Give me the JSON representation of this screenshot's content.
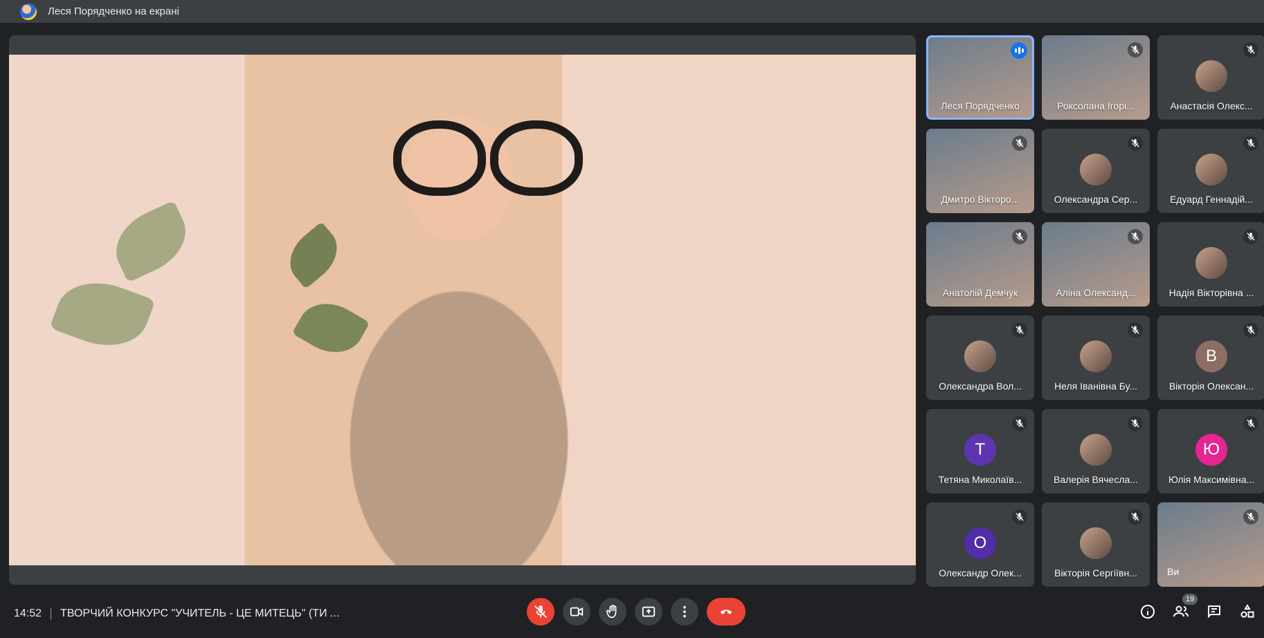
{
  "presenter_bar": {
    "text": "Леся Порядченко на екрані"
  },
  "participants": [
    {
      "name": "Леся Порядченко",
      "type": "video",
      "state": "speaking"
    },
    {
      "name": "Роксолана Ігорі...",
      "type": "video",
      "state": "muted"
    },
    {
      "name": "Анастасія Олекс...",
      "type": "avatar",
      "state": "muted"
    },
    {
      "name": "Дмитро Вікторо...",
      "type": "video",
      "state": "muted"
    },
    {
      "name": "Олександра Сер...",
      "type": "avatar",
      "state": "muted"
    },
    {
      "name": "Едуард Геннадій...",
      "type": "avatar",
      "state": "muted"
    },
    {
      "name": "Анатолій Демчук",
      "type": "video",
      "state": "muted"
    },
    {
      "name": "Аліна Олександ...",
      "type": "video",
      "state": "muted"
    },
    {
      "name": "Надія Вікторівна ...",
      "type": "avatar",
      "state": "muted"
    },
    {
      "name": "Олександра Вол...",
      "type": "avatar",
      "state": "muted"
    },
    {
      "name": "Неля Іванівна Бу...",
      "type": "avatar",
      "state": "muted"
    },
    {
      "name": "Вікторія Олексан...",
      "type": "letter",
      "letter": "В",
      "color": "#8d6e63",
      "state": "muted"
    },
    {
      "name": "Тетяна Миколаїв...",
      "type": "letter",
      "letter": "Т",
      "color": "#5e35b1",
      "state": "muted"
    },
    {
      "name": "Валерія Вячесла...",
      "type": "avatar",
      "state": "muted"
    },
    {
      "name": "Юлія Максимівна...",
      "type": "letter",
      "letter": "Ю",
      "color": "#e52592",
      "state": "muted"
    },
    {
      "name": "Олександр Олек...",
      "type": "letter",
      "letter": "О",
      "color": "#512da8",
      "state": "muted"
    },
    {
      "name": "Вікторія Сергіївн...",
      "type": "avatar",
      "state": "muted"
    },
    {
      "name": "Ви",
      "type": "self",
      "state": "muted"
    }
  ],
  "bottom": {
    "time": "14:52",
    "meeting_title": "ТВОРЧИЙ КОНКУРС \"УЧИТЕЛЬ - ЦЕ МИТЕЦЬ\" (ТИ ...",
    "participants_count": "19"
  },
  "icons": {
    "mic": "mic-off-icon",
    "camera": "camera-icon",
    "hand": "raise-hand-icon",
    "present": "present-icon",
    "more": "more-vert-icon",
    "end": "end-call-icon",
    "info": "info-icon",
    "people": "people-icon",
    "chat": "chat-icon",
    "activities": "activities-icon"
  },
  "colors": {
    "danger": "#ea4335",
    "accent": "#1a73e8",
    "surface": "#3c4043",
    "background": "#202124"
  }
}
